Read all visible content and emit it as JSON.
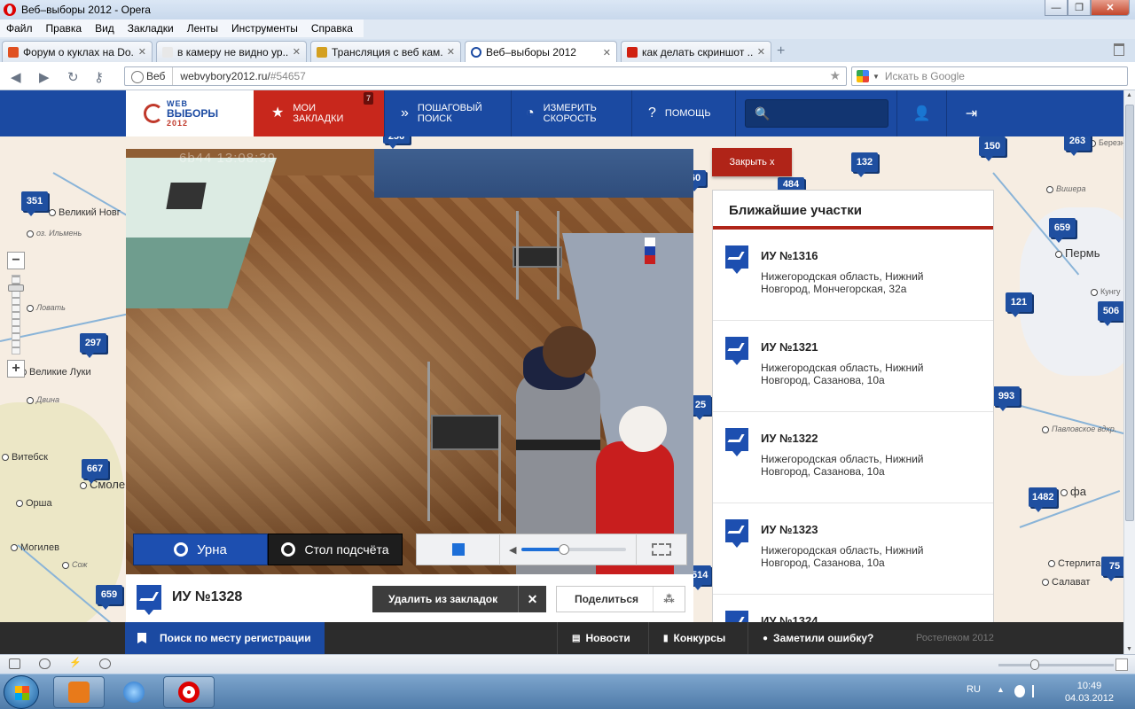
{
  "window": {
    "title": "Веб–выборы 2012 - Opera",
    "controls": [
      "—",
      "❐",
      "✕"
    ]
  },
  "menu": [
    "Файл",
    "Правка",
    "Вид",
    "Закладки",
    "Ленты",
    "Инструменты",
    "Справка"
  ],
  "tabs": [
    {
      "label": "Форум о куклах на Do...",
      "icon_color": "#e05020",
      "active": false
    },
    {
      "label": "в камеру не видно ур...",
      "icon_color": "#e8e8e8",
      "active": false
    },
    {
      "label": "Трансляция с веб кам...",
      "icon_color": "#d4a020",
      "active": false
    },
    {
      "label": "Веб–выборы 2012",
      "icon_color": "#1b4aa2",
      "active": true
    },
    {
      "label": "как делать скриншот ...",
      "icon_color": "#d02010",
      "active": false
    }
  ],
  "address": {
    "site_label": "Веб",
    "url": "webvybory2012.ru/",
    "url_hash": "#54657",
    "search_placeholder": "Искать в Google"
  },
  "site_nav": {
    "logo_line1": "WEB",
    "logo_line2": "ВЫБОРЫ",
    "logo_year": "2012",
    "bookmarks_line1": "МОИ",
    "bookmarks_line2": "ЗАКЛАДКИ",
    "bookmarks_count": "7",
    "search_line1": "ПОШАГОВЫЙ",
    "search_line2": "ПОИСК",
    "speed_line1": "ИЗМЕРИТЬ",
    "speed_line2": "СКОРОСТЬ",
    "help": "ПОМОЩЬ",
    "search_glyph": "🔍"
  },
  "map": {
    "markers": [
      "351",
      "297",
      "667",
      "659",
      "132",
      "484",
      "150",
      "263",
      "659",
      "121",
      "506",
      "993",
      "1482",
      "75",
      "25",
      "514",
      "60",
      "256"
    ],
    "cities": [
      {
        "name": "Великий Новг",
        "cls": ""
      },
      {
        "name": "Великие Луки",
        "cls": ""
      },
      {
        "name": "Витебск",
        "cls": ""
      },
      {
        "name": "Смоле",
        "cls": "big"
      },
      {
        "name": "Орша",
        "cls": ""
      },
      {
        "name": "Могилев",
        "cls": ""
      },
      {
        "name": "Пермь",
        "cls": "big"
      },
      {
        "name": "Стерлитам",
        "cls": ""
      },
      {
        "name": "Салават",
        "cls": ""
      },
      {
        "name": "фа",
        "cls": "big"
      }
    ],
    "labels": [
      "оз. Ильмень",
      "Павловское вдхр.",
      "Кунгу",
      "Березни",
      "Ловать",
      "Сож",
      "Двина",
      "Вишера"
    ]
  },
  "video": {
    "timestamp": "6b44 13:08:39",
    "btn_urna": "Урна",
    "btn_stol": "Стол подсчёта",
    "volume": 0.4
  },
  "station": {
    "title": "ИУ №1328",
    "delete_label": "Удалить из закладок",
    "delete_x": "✕",
    "share_label": "Поделиться",
    "share_icon": "⁂"
  },
  "panel": {
    "close_label": "Закрыть  x",
    "heading": "Ближайшие участки",
    "items": [
      {
        "title": "ИУ №1316",
        "address": "Нижегородская область, Нижний Новгород, Мончегорская, 32а"
      },
      {
        "title": "ИУ №1321",
        "address": "Нижегородская область, Нижний Новгород, Сазанова, 10а"
      },
      {
        "title": "ИУ №1322",
        "address": "Нижегородская область, Нижний Новгород, Сазанова, 10а"
      },
      {
        "title": "ИУ №1323",
        "address": "Нижегородская область, Нижний Новгород, Сазанова, 10а"
      },
      {
        "title": "ИУ №1324",
        "address": ""
      }
    ]
  },
  "bottom": {
    "search_reg": "Поиск по месту регистрации",
    "news": "Новости",
    "contests": "Конкурсы",
    "report": "Заметили ошибку?",
    "copyright": "Ростелеком 2012"
  },
  "taskbar": {
    "lang": "RU",
    "time": "10:49",
    "date": "04.03.2012"
  }
}
